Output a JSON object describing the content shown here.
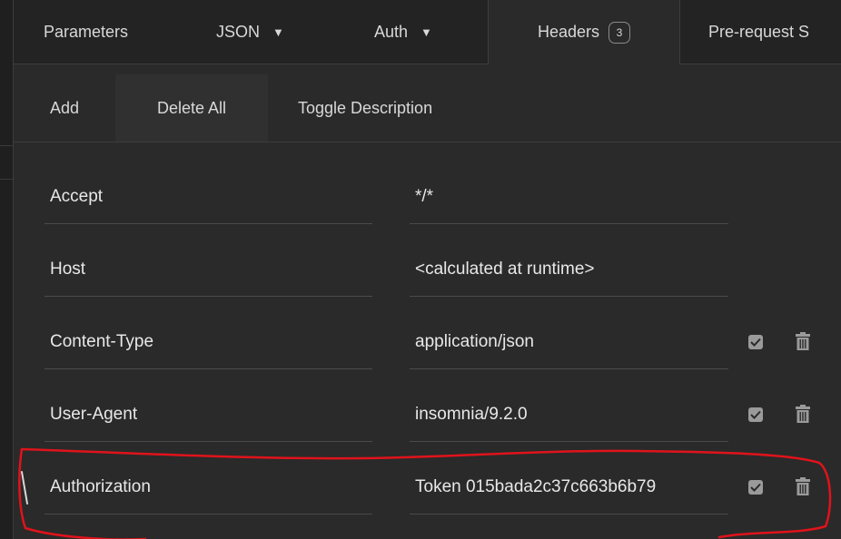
{
  "tabs": [
    {
      "label": "Parameters",
      "caret": false
    },
    {
      "label": "JSON",
      "caret": true
    },
    {
      "label": "Auth",
      "caret": true
    },
    {
      "label": "Headers",
      "badge": "3",
      "active": true
    },
    {
      "label": "Pre-request S"
    }
  ],
  "toolbar": {
    "add_label": "Add",
    "delete_all_label": "Delete All",
    "toggle_description_label": "Toggle Description"
  },
  "headers": [
    {
      "name": "Accept",
      "value": "*/*",
      "controls": false
    },
    {
      "name": "Host",
      "value": "<calculated at runtime>",
      "controls": false
    },
    {
      "name": "Content-Type",
      "value": "application/json",
      "controls": true,
      "enabled": true
    },
    {
      "name": "User-Agent",
      "value": "insomnia/9.2.0",
      "controls": true,
      "enabled": true
    },
    {
      "name": "Authorization",
      "value": "Token 015bada2c37c663b6b79",
      "controls": true,
      "enabled": true
    }
  ],
  "colors": {
    "background": "#2a2a2a",
    "tabbar": "#232323",
    "annotation": "#e0131b"
  }
}
